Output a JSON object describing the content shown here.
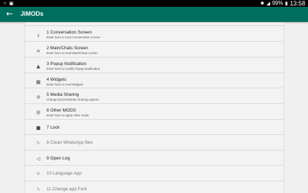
{
  "status_bar": {
    "battery": "99%",
    "time": "13:58"
  },
  "app_bar": {
    "title": "JiMODs"
  },
  "menu": [
    {
      "title": "1 Conversation Screen",
      "subtitle": "Enter here to mod Conversation screen",
      "icon": "upload-icon"
    },
    {
      "title": "2 Main/Chats Screen",
      "subtitle": "Enter here to mod Main/Chats screen",
      "icon": "home-icon"
    },
    {
      "title": "3 Popup Notification",
      "subtitle": "Enter here to modify Popup Notification",
      "icon": "bell-icon"
    },
    {
      "title": "4 Widgets",
      "subtitle": "Enter here to mod Widgets",
      "icon": "widgets-icon"
    },
    {
      "title": "5 Media Sharing",
      "subtitle": "Change pictures/video sharing options",
      "icon": "paperclip-icon"
    },
    {
      "title": "6 Other MODS",
      "subtitle": "Enter here to apply other mods",
      "icon": "list-icon"
    },
    {
      "title": "7 Lock",
      "icon": "lock-icon"
    },
    {
      "title": "8 Clean WhatsApp files",
      "icon": "refresh-icon"
    },
    {
      "title": "9 Open Log",
      "icon": "volume-icon"
    },
    {
      "title": "10 Language App",
      "icon": "language-icon"
    },
    {
      "title": "11 Change app Font",
      "icon": "pencil-icon"
    }
  ]
}
